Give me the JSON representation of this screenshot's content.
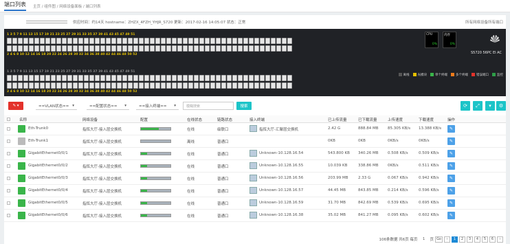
{
  "top": {
    "title": "端口列表",
    "breadcrumb": "主页 / 组件图 / 网络设备面板 / 端口列表"
  },
  "device": {
    "info": "供应时间：约14天  hostname：ZHZX_4FZH_YHJR_S720  更新：2017-02-16 14:05:07  状态：正常",
    "link_right": "所有网络设备所有端口",
    "top_numbers": "1 3 5 7 9 11 13 15 17 19 21 23 25 27 29 31 33 35 37 39 41 43 45 47 49 51",
    "mid_numbers": "2 4 6 8 10 12 14 16 18 20 22 24 26 28 30 32 34 36 38 40 42 44 46 48 50 52",
    "lower_top_numbers": "1 3 5 7 9 11 13 15 17 19 21 23 25 27 29 31 33 35 37 39 41 43 45 47 49 51",
    "bottom_numbers": "2 4 6 8 10 12 14 16 18 20 22 24 26 28 30 32 34 36 38 40 42 44 46 48 50 52",
    "cpu_label": "CPU",
    "cpu_value": "0%",
    "mem_label": "内存",
    "mem_value": "0%",
    "model": "S5720 56PC EI AC",
    "legend": [
      {
        "label": "离线",
        "color": "#555555"
      },
      {
        "label": "光模块",
        "color": "#e5c000"
      },
      {
        "label": "单个终端",
        "color": "#3ab54a"
      },
      {
        "label": "多个终端",
        "color": "#f07b1a"
      },
      {
        "label": "错误端口",
        "color": "#e3322b"
      },
      {
        "label": "监控",
        "color": "#2e9e48"
      }
    ]
  },
  "toolbar": {
    "vlan": "==VLAN状态==",
    "config": "==配置状态==",
    "access": "==接入终端==",
    "search_placeholder": "模糊搜索",
    "search_btn": "搜索"
  },
  "columns": [
    "名称",
    "网络设备",
    "配置",
    "在线状态",
    "链路状态",
    "接入终端",
    "已上传流量",
    "已下载流量",
    "上传速度",
    "下载速度",
    "操作"
  ],
  "rows": [
    {
      "name": "Eth-Trunk0",
      "device": "指挥大厅-接入层交换机",
      "config": 0.6,
      "online": "在线",
      "link": "级联口",
      "terminal": "指挥大厅-汇聚层交换机",
      "up": "2.42 G",
      "down": "888.84 MB",
      "upspeed": "85.305 KB/s",
      "downspeed": "13.388 KB/s",
      "icon": "#3ab54a"
    },
    {
      "name": "Eth-Trunk1",
      "device": "指挥大厅-接入层交换机",
      "config": 0,
      "online": "离线",
      "link": "普通口",
      "terminal": "",
      "up": "0KB",
      "down": "0KB",
      "upspeed": "0KB/s",
      "downspeed": "0KB/s",
      "icon": "#bbbbbb"
    },
    {
      "name": "GigabitEthernet0/0/1",
      "device": "指挥大厅-接入层交换机",
      "config": 0.2,
      "online": "在线",
      "link": "普通口",
      "terminal": "Unknown-10.128.16.54",
      "up": "543.800 KB",
      "down": "340.26 MB",
      "upspeed": "0.508 KB/s",
      "downspeed": "0.509 KB/s",
      "icon": "#3ab54a"
    },
    {
      "name": "GigabitEthernet0/0/2",
      "device": "指挥大厅-接入层交换机",
      "config": 0.2,
      "online": "在线",
      "link": "普通口",
      "terminal": "Unknown-10.128.16.55",
      "up": "10.039 KB",
      "down": "338.86 MB",
      "upspeed": "0KB/s",
      "downspeed": "0.511 KB/s",
      "icon": "#3ab54a"
    },
    {
      "name": "GigabitEthernet0/0/3",
      "device": "指挥大厅-接入层交换机",
      "config": 0.2,
      "online": "在线",
      "link": "普通口",
      "terminal": "Unknown-10.128.16.56",
      "up": "203.99 MB",
      "down": "2.33 G",
      "upspeed": "0.067 KB/s",
      "downspeed": "0.942 KB/s",
      "icon": "#3ab54a"
    },
    {
      "name": "GigabitEthernet0/0/4",
      "device": "指挥大厅-接入层交换机",
      "config": 0.2,
      "online": "在线",
      "link": "普通口",
      "terminal": "Unknown-10.128.16.57",
      "up": "44.45 MB",
      "down": "843.85 MB",
      "upspeed": "0.214 KB/s",
      "downspeed": "0.596 KB/s",
      "icon": "#3ab54a"
    },
    {
      "name": "GigabitEthernet0/0/5",
      "device": "指挥大厅-接入层交换机",
      "config": 0.2,
      "online": "在线",
      "link": "普通口",
      "terminal": "Unknown-10.128.16.59",
      "up": "31.70 MB",
      "down": "842.69 MB",
      "upspeed": "0.539 KB/s",
      "downspeed": "0.695 KB/s",
      "icon": "#3ab54a"
    },
    {
      "name": "GigabitEthernet0/0/6",
      "device": "指挥大厅-接入层交换机",
      "config": 0.2,
      "online": "在线",
      "link": "普通口",
      "terminal": "Unknown-10.128.16.38",
      "up": "35.02 MB",
      "down": "841.27 MB",
      "upspeed": "0.095 KB/s",
      "downspeed": "0.602 KB/s",
      "icon": "#3ab54a"
    }
  ],
  "pagination": {
    "summary": "106条数据 共6页 每页",
    "per": "1",
    "page_label": "页",
    "go": "Go",
    "pages": [
      "1",
      "2",
      "3",
      "4",
      "5",
      "6"
    ]
  }
}
